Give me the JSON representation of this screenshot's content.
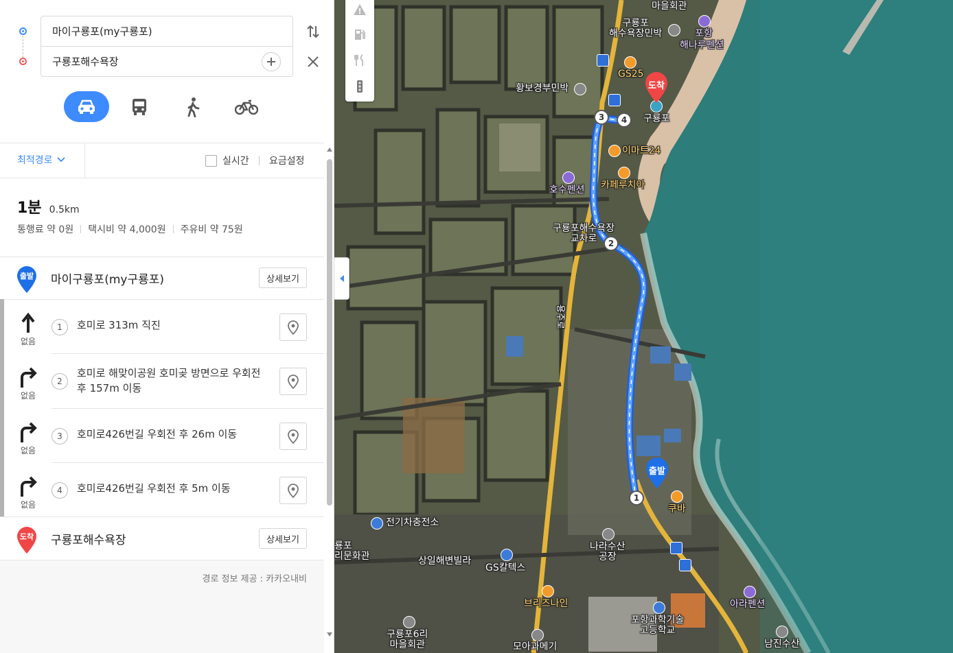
{
  "route_inputs": {
    "start": "마이구룡포(my구룡포)",
    "end": "구룡포해수욕장"
  },
  "modes": [
    {
      "name": "car",
      "icon": "car-icon",
      "active": true
    },
    {
      "name": "bus",
      "icon": "bus-icon",
      "active": false
    },
    {
      "name": "walk",
      "icon": "walk-icon",
      "active": false
    },
    {
      "name": "bike",
      "icon": "bike-icon",
      "active": false
    }
  ],
  "options": {
    "route_type": "최적경로",
    "realtime_label": "실시간",
    "fare_settings": "요금설정"
  },
  "summary": {
    "time": "1분",
    "distance": "0.5km",
    "toll": "통행료 약 0원",
    "taxi": "택시비 약 4,000원",
    "fuel": "주유비 약 75원"
  },
  "start_place": {
    "badge": "출발",
    "name": "마이구룡포(my구룡포)",
    "detail": "상세보기"
  },
  "end_place": {
    "badge": "도착",
    "name": "구룡포해수욕장",
    "detail": "상세보기"
  },
  "steps": [
    {
      "num": "1",
      "turn": "straight",
      "label": "없음",
      "text": "호미로 313m 직진"
    },
    {
      "num": "2",
      "turn": "right",
      "label": "없음",
      "text": "호미로 해맞이공원 호미곶 방면으로 우회전 후 157m 이동"
    },
    {
      "num": "3",
      "turn": "right",
      "label": "없음",
      "text": "호미로426번길 우회전 후 26m 이동"
    },
    {
      "num": "4",
      "turn": "right",
      "label": "없음",
      "text": "호미로426번길 우회전 후 5m 이동"
    }
  ],
  "credit": "경로 정보 제공 : 카카오내비",
  "map": {
    "labels": {
      "village_hall": "마을회관",
      "beach_lodge": "구룡포\n해수욕장민박",
      "pohang": "포항",
      "haenaru": "해나루펜션",
      "gs25": "GS25",
      "hwangbo": "황보경부민박",
      "guryongpo": "구룡포",
      "emart24": "이마트24",
      "hosu": "호수펜션",
      "cafe": "카페루치아",
      "intersection": "구룡포해수욕장\n교차로",
      "road": "용주로",
      "ev_charge": "전기차충전소",
      "guryongpo_hall": "룡포\n리문화관",
      "sangil": "상일해변빌라",
      "gs_caltex": "GS칼텍스",
      "nara": "나라수산\n공장",
      "kuba": "쿠바",
      "breeze": "브리즈나인",
      "tech_school": "포항과학기술\n고등학교",
      "ara": "아라펜션",
      "guryongpo6": "구룡포6리\n마을회관",
      "moa": "모아과메기",
      "namjin": "남진수산"
    },
    "pins": {
      "start": "출발",
      "end": "도착"
    },
    "waypoints": [
      "1",
      "2",
      "3",
      "4"
    ],
    "colors": {
      "route": "#3d8bff",
      "start_pin": "#1e6fe8",
      "end_pin": "#f04646",
      "sea": "#2d7d7a"
    }
  }
}
